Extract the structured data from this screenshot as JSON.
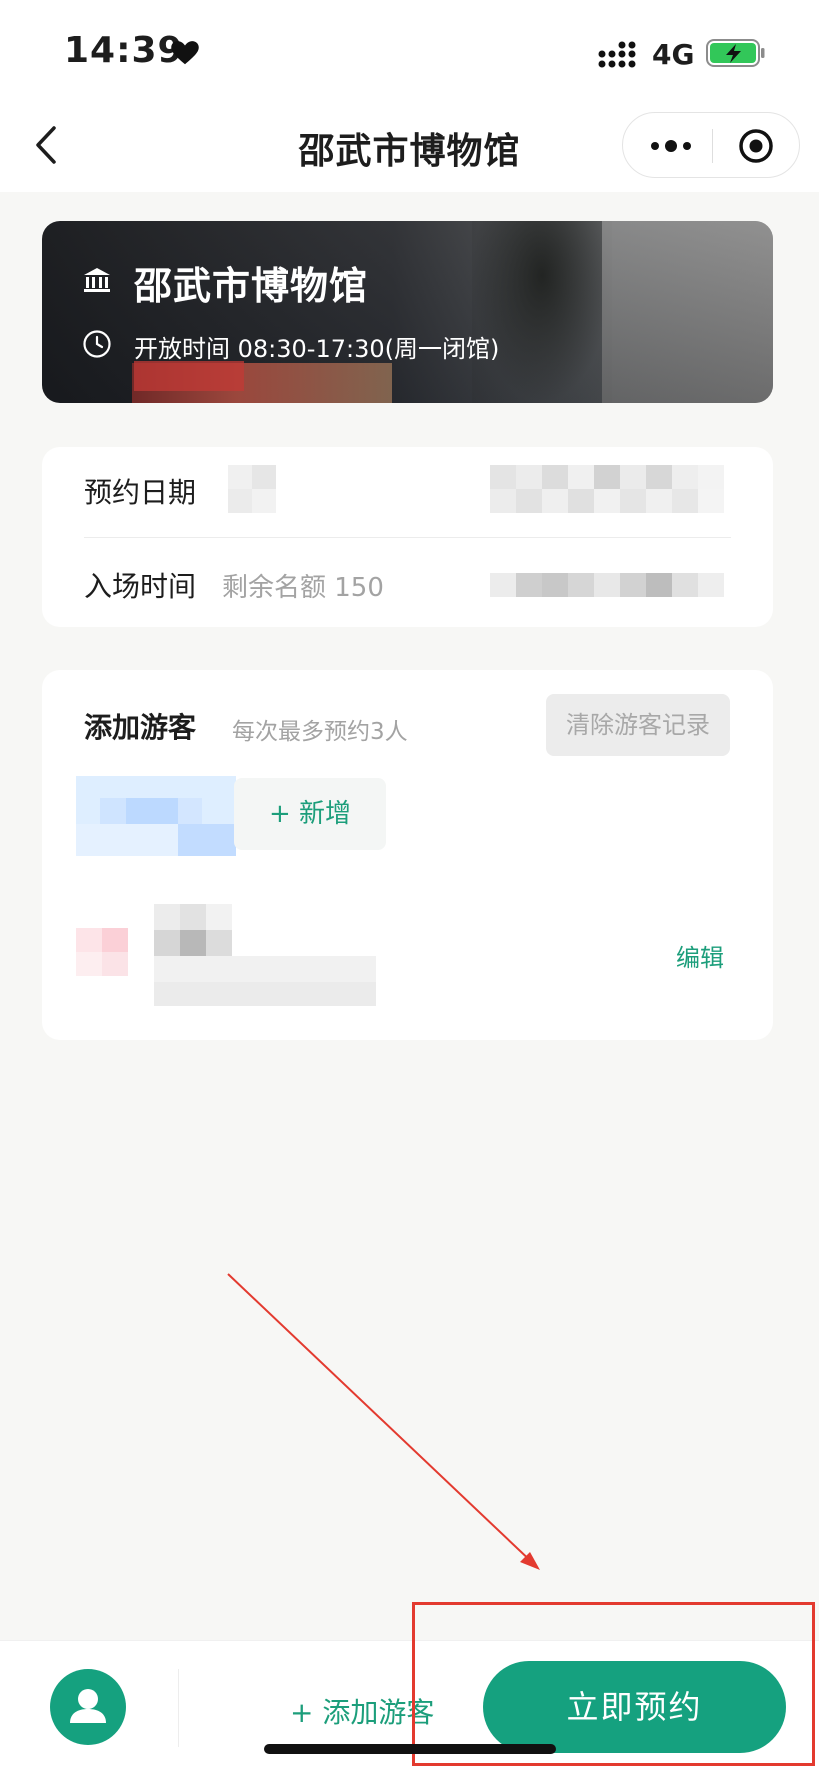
{
  "status_bar": {
    "time": "14:39",
    "network": "4G"
  },
  "nav": {
    "title": "邵武市博物馆"
  },
  "banner": {
    "title": "邵武市博物馆",
    "hours": "开放时间 08:30-17:30(周一闭馆)"
  },
  "booking": {
    "date_label": "预约日期",
    "time_label": "入场时间",
    "remaining": "剩余名额 150"
  },
  "visitors": {
    "title": "添加游客",
    "note": "每次最多预约3人",
    "clear_label": "清除游客记录",
    "add_new_label": "+ 新增",
    "edit_label": "编辑"
  },
  "bottom_bar": {
    "add_visitor_label": "+ 添加游客",
    "reserve_label": "立即预约"
  },
  "colors": {
    "accent": "#15a17f",
    "accent_text": "#1c9e7b",
    "annotation": "#e33a2f"
  }
}
